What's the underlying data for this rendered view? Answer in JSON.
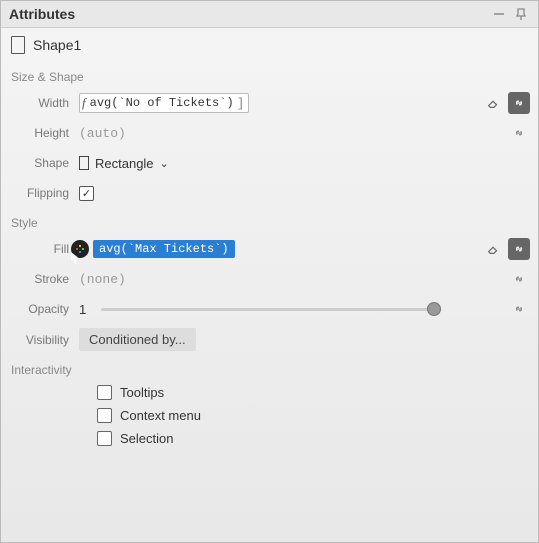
{
  "panel": {
    "title": "Attributes"
  },
  "shape": {
    "name": "Shape1"
  },
  "sections": {
    "size_shape": "Size & Shape",
    "style": "Style",
    "interactivity": "Interactivity"
  },
  "labels": {
    "width": "Width",
    "height": "Height",
    "shape": "Shape",
    "flipping": "Flipping",
    "fill": "Fill",
    "stroke": "Stroke",
    "opacity": "Opacity",
    "visibility": "Visibility"
  },
  "values": {
    "width_expr": "avg(`No of Tickets`)",
    "height": "(auto)",
    "shape_type": "Rectangle",
    "flipping_checked": true,
    "fill_expr": "avg(`Max Tickets`)",
    "stroke": "(none)",
    "opacity": "1",
    "visibility_btn": "Conditioned by..."
  },
  "interactivity": {
    "tooltips": {
      "label": "Tooltips",
      "checked": false
    },
    "context_menu": {
      "label": "Context menu",
      "checked": false
    },
    "selection": {
      "label": "Selection",
      "checked": false
    }
  }
}
